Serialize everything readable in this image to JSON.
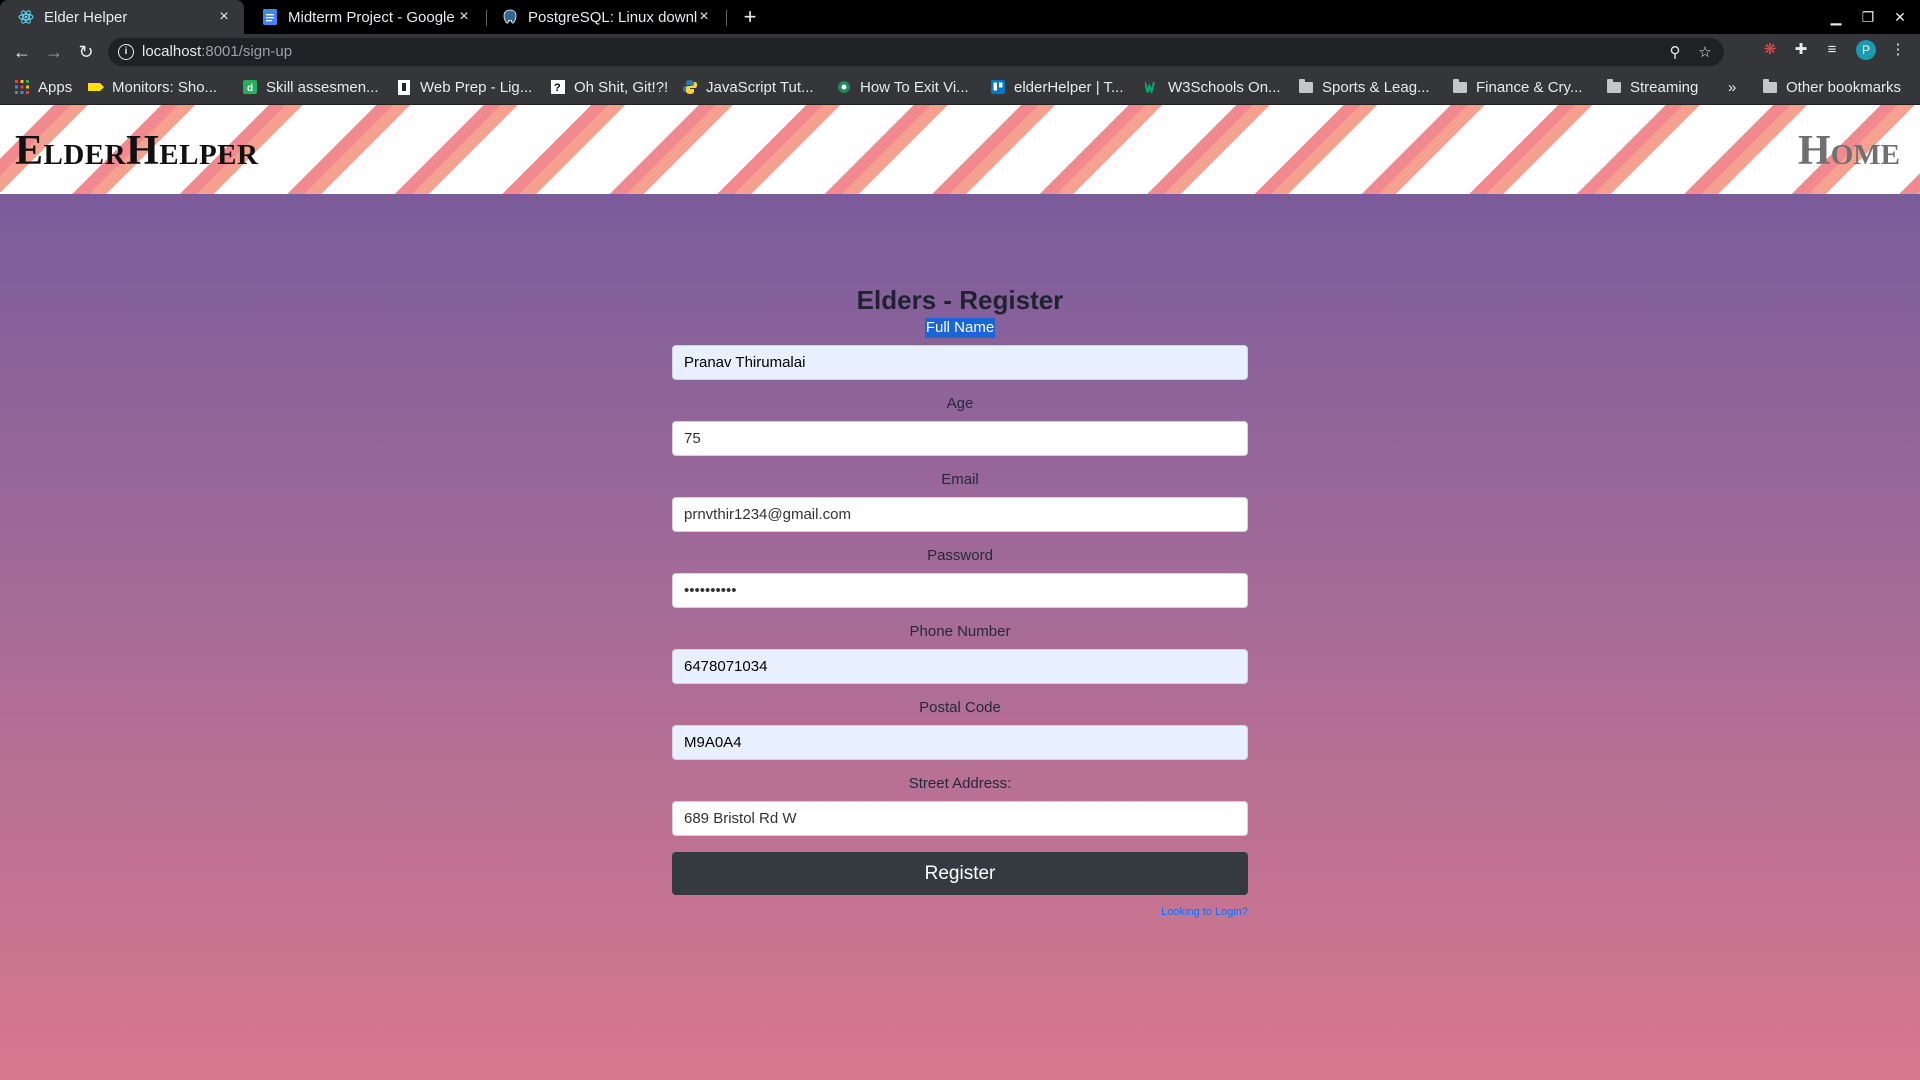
{
  "browser": {
    "tabs": [
      {
        "title": "Elder Helper",
        "active": true,
        "icon": "react-icon"
      },
      {
        "title": "Midterm Project - Google",
        "active": false,
        "icon": "google-docs-icon"
      },
      {
        "title": "PostgreSQL: Linux downl",
        "active": false,
        "icon": "postgresql-icon"
      }
    ],
    "url_host": "localhost",
    "url_rest": ":8001/sign-up",
    "bookmarks": [
      {
        "label": "Apps",
        "icon": "apps-grid-icon"
      },
      {
        "label": "Monitors: Sho...",
        "icon": "bestbuy-icon"
      },
      {
        "label": "Skill assesmen...",
        "icon": "d-logo-icon"
      },
      {
        "label": "Web Prep - Lig...",
        "icon": "page-icon"
      },
      {
        "label": "Oh Shit, Git!?!",
        "icon": "question-icon"
      },
      {
        "label": "JavaScript Tut...",
        "icon": "python-icon"
      },
      {
        "label": "How To Exit Vi...",
        "icon": "globe-icon"
      },
      {
        "label": "elderHelper | T...",
        "icon": "trello-icon"
      },
      {
        "label": "W3Schools On...",
        "icon": "w3schools-icon"
      },
      {
        "label": "Sports & Leag...",
        "icon": "folder-icon"
      },
      {
        "label": "Finance & Cry...",
        "icon": "folder-icon"
      },
      {
        "label": "Streaming",
        "icon": "folder-icon"
      }
    ],
    "bookmarks_overflow": "»",
    "other_bookmarks": "Other bookmarks",
    "profile_initial": "P"
  },
  "site": {
    "brand": "ElderHelper",
    "home": "Home"
  },
  "form": {
    "title": "Elders - Register",
    "fields": [
      {
        "label": "Full Name",
        "value": "Pranav Thirumalai",
        "autofill": true,
        "selected_label": true
      },
      {
        "label": "Age",
        "value": "75",
        "autofill": false
      },
      {
        "label": "Email",
        "value": "prnvthir1234@gmail.com",
        "autofill": false
      },
      {
        "label": "Password",
        "value": "••••••••••",
        "autofill": false
      },
      {
        "label": "Phone Number",
        "value": "6478071034",
        "autofill": true
      },
      {
        "label": "Postal Code",
        "value": "M9A0A4",
        "autofill": true
      },
      {
        "label": "Street Address:",
        "value": "689 Bristol Rd W",
        "autofill": false
      }
    ],
    "submit_label": "Register",
    "login_link": "Looking to Login?"
  },
  "colors": {
    "gradient_top": "#7a5c9b",
    "gradient_bottom": "#d8788d",
    "button": "#343a40",
    "link": "#0d6efd"
  }
}
